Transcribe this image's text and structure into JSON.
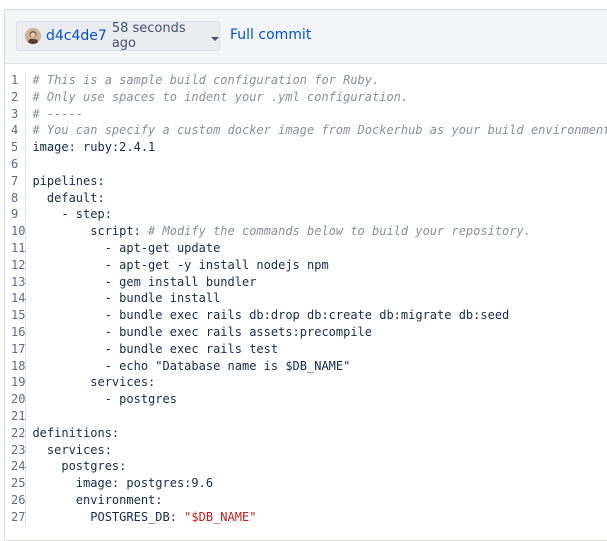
{
  "header": {
    "commit_hash": "d4c4de7",
    "time_ago": "58 seconds ago",
    "full_commit_label": "Full commit",
    "avatar_icon": "user-avatar",
    "caret_icon": "chevron-down-icon"
  },
  "colors": {
    "link": "#0052cc",
    "comment": "#8a8f98",
    "string": "#c41a16",
    "text": "#172b4d",
    "header_bg": "#f4f5f7"
  },
  "code": {
    "line_numbers": [
      "1",
      "2",
      "3",
      "4",
      "5",
      "6",
      "7",
      "8",
      "9",
      "10",
      "11",
      "12",
      "13",
      "14",
      "15",
      "16",
      "17",
      "18",
      "19",
      "20",
      "21",
      "22",
      "23",
      "24",
      "25",
      "26",
      "27"
    ],
    "lines": [
      {
        "code": "",
        "comment": "# This is a sample build configuration for Ruby."
      },
      {
        "code": "",
        "comment": "# Only use spaces to indent your .yml configuration."
      },
      {
        "code": "",
        "comment": "# -----"
      },
      {
        "code": "",
        "comment": "# You can specify a custom docker image from Dockerhub as your build environment."
      },
      {
        "code": "image: ruby:2.4.1"
      },
      {
        "code": ""
      },
      {
        "code": "pipelines:"
      },
      {
        "code": "  default:"
      },
      {
        "code": "    - step:"
      },
      {
        "code": "        script: ",
        "comment": "# Modify the commands below to build your repository."
      },
      {
        "code": "          - apt-get update"
      },
      {
        "code": "          - apt-get -y install nodejs npm"
      },
      {
        "code": "          - gem install bundler"
      },
      {
        "code": "          - bundle install"
      },
      {
        "code": "          - bundle exec rails db:drop db:create db:migrate db:seed"
      },
      {
        "code": "          - bundle exec rails assets:precompile"
      },
      {
        "code": "          - bundle exec rails test"
      },
      {
        "code": "          - echo \"Database name is $DB_NAME\""
      },
      {
        "code": "        services:"
      },
      {
        "code": "          - postgres"
      },
      {
        "code": ""
      },
      {
        "code": "definitions:"
      },
      {
        "code": "  services:"
      },
      {
        "code": "    postgres:"
      },
      {
        "code": "      image: postgres:9.6"
      },
      {
        "code": "      environment:"
      },
      {
        "code": "        POSTGRES_DB: ",
        "string": "\"$DB_NAME\""
      }
    ]
  }
}
